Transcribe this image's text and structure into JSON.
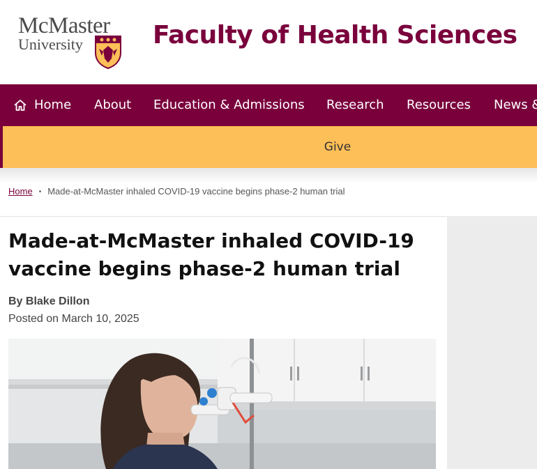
{
  "header": {
    "logo_line1": "McMaster",
    "logo_line2": "University",
    "site_title": "Faculty of Health Sciences"
  },
  "nav": {
    "items": [
      {
        "label": "Home",
        "icon": "home-icon"
      },
      {
        "label": "About"
      },
      {
        "label": "Education & Admissions"
      },
      {
        "label": "Research"
      },
      {
        "label": "Resources"
      },
      {
        "label": "News &"
      }
    ]
  },
  "give_bar": {
    "label": "Give"
  },
  "breadcrumb": {
    "home": "Home",
    "separator": "•",
    "current": "Made-at-McMaster inhaled COVID-19 vaccine begins phase-2 human trial"
  },
  "article": {
    "title": "Made-at-McMaster inhaled COVID-19 vaccine begins phase-2 human trial",
    "byline": "By Blake Dillon",
    "posted": "Posted on March 10, 2025"
  },
  "colors": {
    "brand_maroon": "#7a003c",
    "gold": "#fdbf57",
    "logo_gray": "#4a4a4a"
  }
}
